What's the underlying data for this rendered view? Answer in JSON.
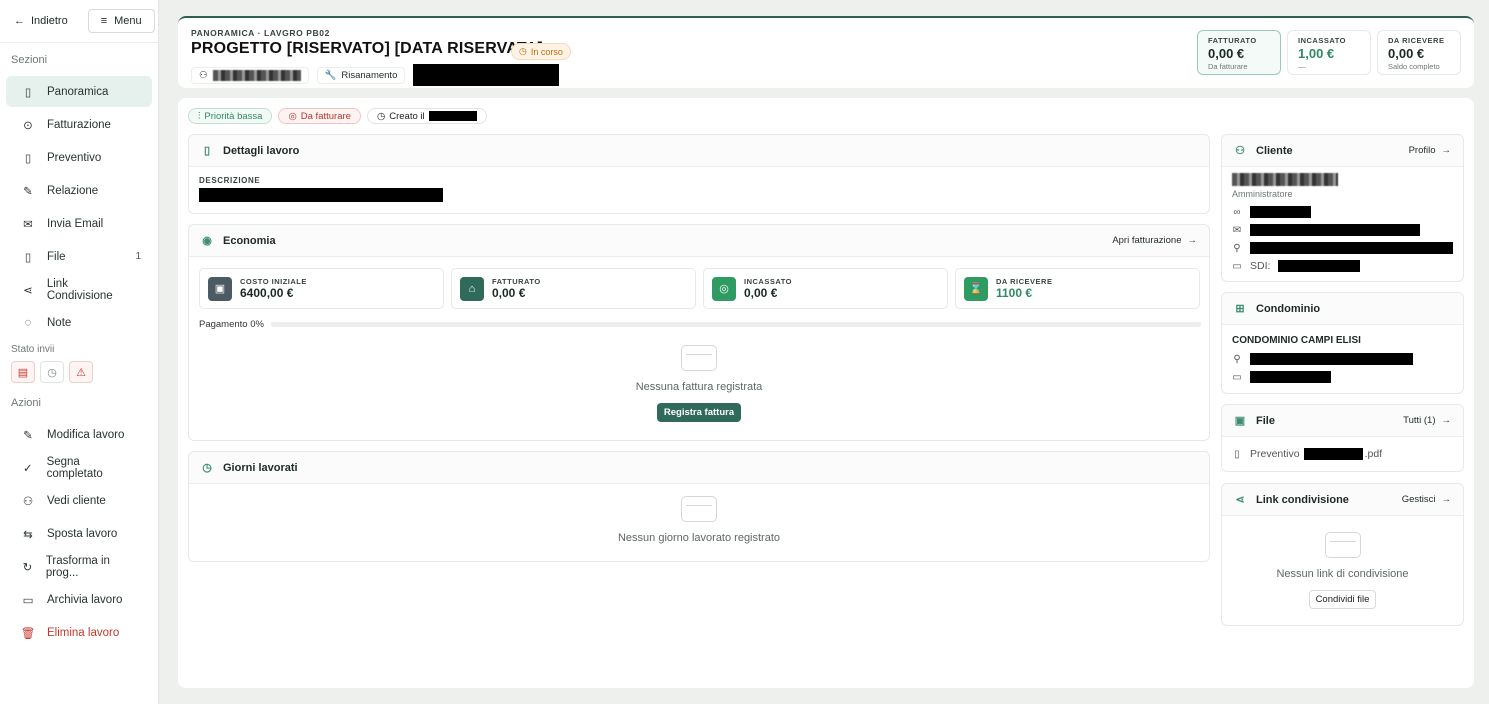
{
  "sidebar": {
    "back_label": "Indietro",
    "menu_label": "Menu",
    "section_sezioni": "Sezioni",
    "items": [
      {
        "label": "Panoramica"
      },
      {
        "label": "Fatturazione"
      },
      {
        "label": "Preventivo"
      },
      {
        "label": "Relazione"
      },
      {
        "label": "Invia Email"
      },
      {
        "label": "File",
        "count": "1"
      },
      {
        "label": "Link Condivisione"
      },
      {
        "label": "Note"
      }
    ],
    "section_stato": "Stato invii",
    "section_azioni": "Azioni",
    "actions": [
      {
        "label": "Modifica lavoro"
      },
      {
        "label": "Segna completato"
      },
      {
        "label": "Vedi cliente"
      },
      {
        "label": "Sposta lavoro"
      },
      {
        "label": "Trasforma in prog..."
      },
      {
        "label": "Archivia lavoro"
      },
      {
        "label": "Elimina lavoro"
      }
    ]
  },
  "header": {
    "breadcrumb": "PANORAMICA · LAVGRO PB02",
    "title": "PROGETTO [RISERVATO] [DATA RISERVATA]",
    "status": "In corso",
    "category": "Risanamento"
  },
  "kpis": [
    {
      "label": "FATTURATO",
      "value": "0,00 €",
      "sub": "Da fatturare"
    },
    {
      "label": "INCASSATO",
      "value": "1,00 €",
      "sub": "—"
    },
    {
      "label": "DA RICEVERE",
      "value": "0,00 €",
      "sub": "Saldo completo"
    }
  ],
  "tags": {
    "priority": "Priorità bassa",
    "billing": "Da fatturare",
    "created": "Creato il"
  },
  "dettagli": {
    "title": "Dettagli lavoro",
    "desc_label": "DESCRIZIONE"
  },
  "economia": {
    "title": "Economia",
    "link": "Apri fatturazione",
    "cards": [
      {
        "label": "COSTO INIZIALE",
        "value": "6400,00 €"
      },
      {
        "label": "FATTURATO",
        "value": "0,00 €"
      },
      {
        "label": "INCASSATO",
        "value": "0,00 €"
      },
      {
        "label": "DA RICEVERE",
        "value": "1100 €"
      }
    ],
    "payment_label": "Pagamento 0%",
    "payment_progress": 0,
    "empty_text": "Nessuna fattura registrata",
    "button": "Registra fattura"
  },
  "giorni": {
    "title": "Giorni lavorati",
    "empty_text": "Nessun giorno lavorato registrato"
  },
  "cliente": {
    "title": "Cliente",
    "link": "Profilo",
    "role": "Amministratore",
    "sdi_label": "SDI:"
  },
  "condominio": {
    "title": "Condominio",
    "name": "CONDOMINIO CAMPI ELISI"
  },
  "files": {
    "title": "File",
    "link": "Tutti (1)",
    "file_prefix": "Preventivo",
    "file_ext": ".pdf"
  },
  "share": {
    "title": "Link condivisione",
    "link": "Gestisci",
    "empty_text": "Nessun link di condivisione",
    "button": "Condividi file"
  },
  "colors": {
    "accent": "#2f6a5b",
    "green": "#2f8a62",
    "danger": "#c0392b",
    "warning": "#b8720f"
  }
}
